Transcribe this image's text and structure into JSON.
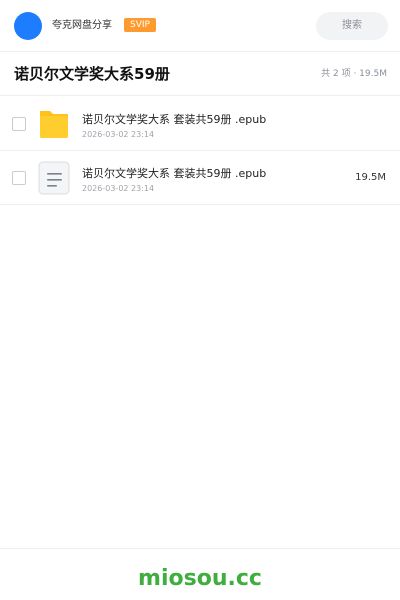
{
  "topbar": {
    "share_title": "夸克网盘分享",
    "badge": "SVIP",
    "search_label": "搜索",
    "accent_color": "#1e7cff",
    "badge_color": "#ff9a2e"
  },
  "header": {
    "title": "诺贝尔文学奖大系59册",
    "summary": "共 2 项 · 19.5M"
  },
  "files": [
    {
      "icon": "folder-icon",
      "name": "诺贝尔文学奖大系 套装共59册 .epub",
      "date": "2026-03-02 23:14",
      "size": ""
    },
    {
      "icon": "document-icon",
      "name": "诺贝尔文学奖大系 套装共59册 .epub",
      "date": "2026-03-02 23:14",
      "size": "19.5M"
    }
  ],
  "footer": {
    "watermark": "miosou.cc",
    "watermark_color": "#3fae3f"
  }
}
